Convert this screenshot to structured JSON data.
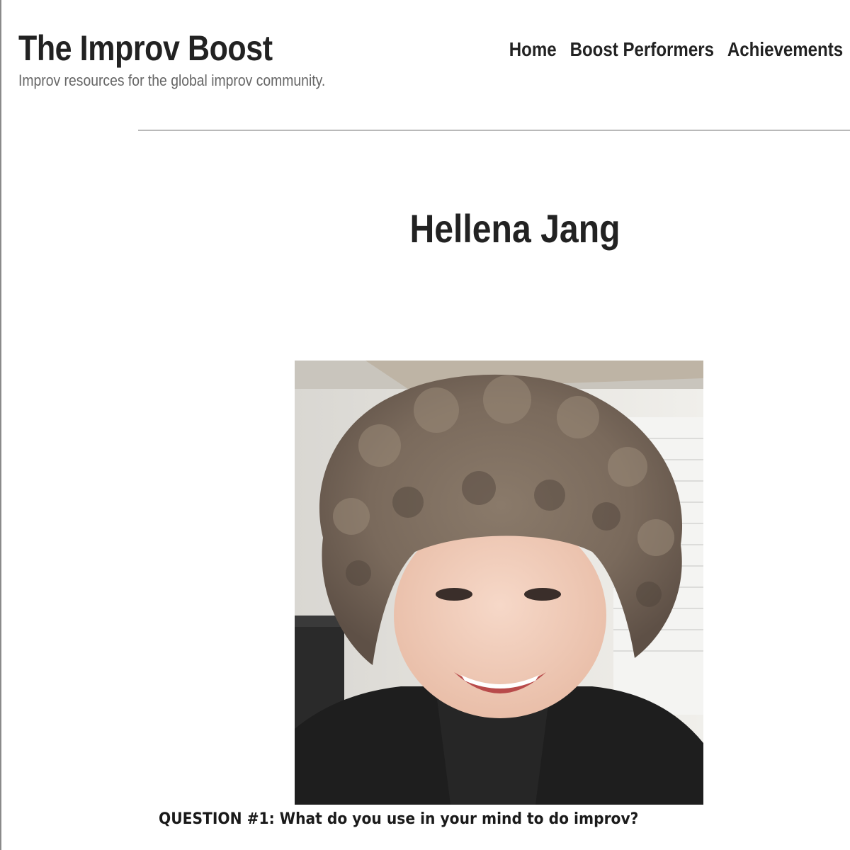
{
  "site": {
    "title": "The Improv Boost",
    "tagline": "Improv resources for the global improv community."
  },
  "nav": {
    "items": [
      {
        "label": "Home"
      },
      {
        "label": "Boost Performers"
      },
      {
        "label": "Achievements"
      }
    ]
  },
  "entry": {
    "title": "Hellena Jang",
    "question": "QUESTION #1: What do you use in your mind to do improv?"
  },
  "colors": {
    "text": "#222222",
    "tagline": "#666666",
    "divider": "#b9b9b9"
  }
}
